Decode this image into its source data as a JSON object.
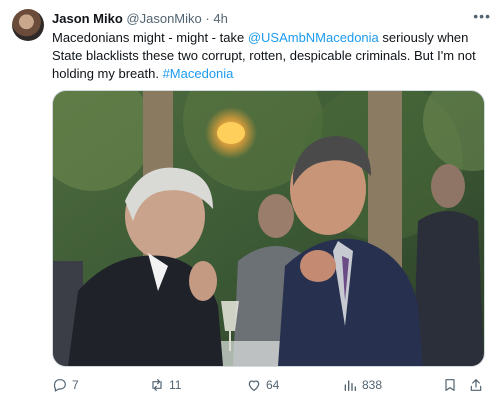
{
  "tweet": {
    "author_name": "Jason Miko",
    "author_handle": "@JasonMiko",
    "separator": "·",
    "time": "4h",
    "text_before_mention": "Macedonians might - might  - take ",
    "mention": "@USAmbNMacedonia",
    "text_after_mention": " seriously when State blacklists these two corrupt, rotten, despicable criminals.  But I'm not holding my breath. ",
    "hashtag": "#Macedonia"
  },
  "actions": {
    "replies": "7",
    "reposts": "11",
    "likes": "64",
    "views": "838"
  },
  "icons": {
    "more": "more-icon",
    "reply": "reply-icon",
    "repost": "repost-icon",
    "like": "heart-icon",
    "views": "views-icon",
    "bookmark": "bookmark-icon",
    "share": "share-icon"
  },
  "colors": {
    "link": "#1d9bf0",
    "secondary_text": "#536471"
  }
}
